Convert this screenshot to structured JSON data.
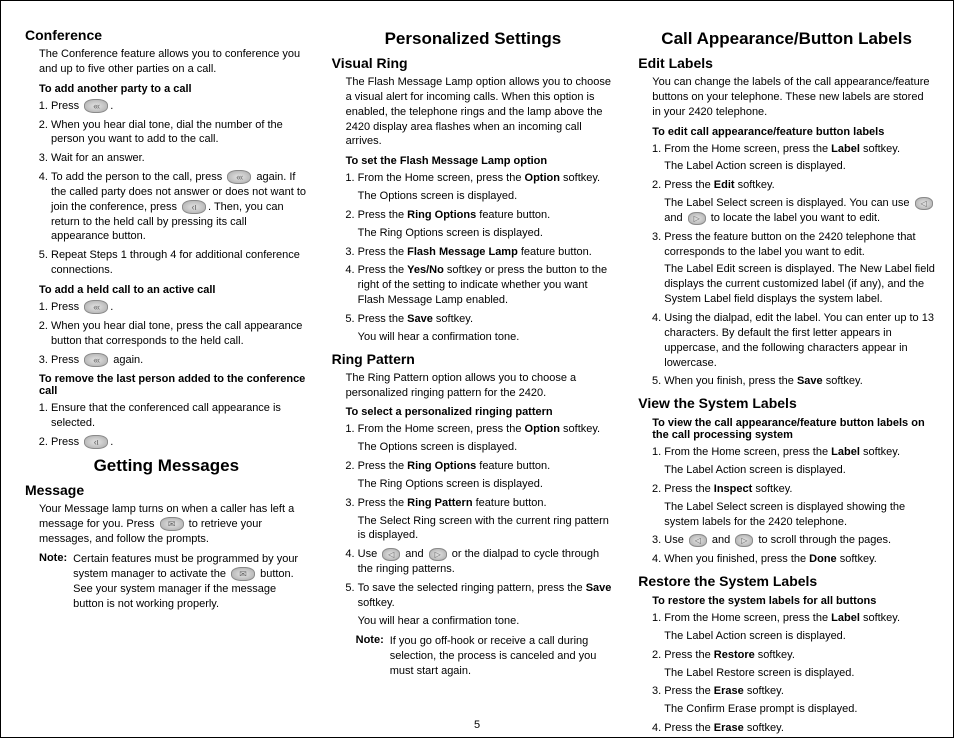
{
  "pageNumber": "5",
  "col1": {
    "conference": {
      "title": "Conference",
      "intro": "The Conference feature allows you to conference you and up to five other parties on a call.",
      "addParty": {
        "heading": "To add another party to a call",
        "s1a": "Press ",
        "s1b": ".",
        "s2": "When you hear dial tone, dial the number of the person you want to add to the call.",
        "s3": "Wait for an answer.",
        "s4a": "To add the person to the call, press ",
        "s4b": " again. If the called party does not answer or does not want to join the conference, press ",
        "s4c": ". Then, you can return to the held call by pressing its call appearance button.",
        "s5": "Repeat Steps 1 through 4 for additional conference connections."
      },
      "addHeld": {
        "heading": "To add a held call to an active call",
        "s1a": "Press ",
        "s1b": ".",
        "s2": "When you hear dial tone, press the call appearance button that corresponds to the held call.",
        "s3a": "Press ",
        "s3b": " again."
      },
      "removeLast": {
        "heading": "To remove the last person added to the conference call",
        "s1": "Ensure that the conferenced call appearance is selected.",
        "s2a": "Press ",
        "s2b": "."
      }
    },
    "gettingMessages": {
      "title": "Getting Messages",
      "messageHeading": "Message",
      "p1a": "Your Message lamp turns on when a caller has left a message for you. Press ",
      "p1b": " to retrieve your messages, and follow the prompts.",
      "noteLabel": "Note:",
      "noteA": "Certain features must be programmed by your system manager to activate the ",
      "noteB": " button. See your system manager if the message button is not working properly."
    }
  },
  "col2": {
    "title": "Personalized Settings",
    "visualRing": {
      "heading": "Visual Ring",
      "intro": "The Flash Message Lamp option allows you to choose a visual alert for incoming calls. When this option is enabled, the telephone rings and the lamp above the 2420 display area flashes when an incoming call arrives.",
      "procHeading": "To set the Flash Message Lamp option",
      "s1a": "From the Home screen, press the ",
      "s1b": "Option",
      "s1c": " softkey.",
      "s1r": "The Options screen is displayed.",
      "s2a": "Press the ",
      "s2b": "Ring Options",
      "s2c": " feature button.",
      "s2r": "The Ring Options screen is displayed.",
      "s3a": "Press the ",
      "s3b": "Flash Message Lamp",
      "s3c": " feature button.",
      "s4a": "Press the ",
      "s4b": "Yes/No",
      "s4c": " softkey or press the button to the right of the setting to indicate whether you want Flash Message Lamp enabled.",
      "s5a": "Press the ",
      "s5b": "Save",
      "s5c": " softkey.",
      "s5r": "You will hear a confirmation tone."
    },
    "ringPattern": {
      "heading": "Ring Pattern",
      "intro": "The Ring Pattern option allows you to choose a personalized ringing pattern for the 2420.",
      "procHeading": "To select a personalized ringing pattern",
      "s1a": "From the Home screen, press the ",
      "s1b": "Option",
      "s1c": " softkey.",
      "s1r": "The Options screen is displayed.",
      "s2a": "Press the ",
      "s2b": "Ring Options",
      "s2c": " feature button.",
      "s2r": "The Ring Options screen is displayed.",
      "s3a": "Press the ",
      "s3b": "Ring Pattern",
      "s3c": " feature button.",
      "s3r": "The Select Ring screen with the current ring pattern is displayed.",
      "s4a": "Use ",
      "s4b": " and ",
      "s4c": " or the dialpad to cycle through the ringing patterns.",
      "s5a": "To save the selected ringing pattern, press the ",
      "s5b": "Save",
      "s5c": " softkey.",
      "s5r": "You will hear a confirmation tone.",
      "noteLabel": "Note:",
      "noteText": "If you go off-hook or receive a call during selection, the process is canceled and you must start again."
    }
  },
  "col3": {
    "title": "Call Appearance/Button Labels",
    "editLabels": {
      "heading": "Edit Labels",
      "intro": "You can change the labels of the call appearance/feature buttons on your telephone. These new labels are stored in your 2420 telephone.",
      "procHeading": "To edit call appearance/feature button labels",
      "s1a": "From the Home screen, press the ",
      "s1b": "Label",
      "s1c": " softkey.",
      "s1r": "The Label Action screen is displayed.",
      "s2a": "Press the ",
      "s2b": "Edit",
      "s2c": " softkey.",
      "s2rA": "The Label Select screen is displayed. You can use ",
      "s2rB": " and ",
      "s2rC": " to locate the label you want to edit.",
      "s3": "Press the feature button on the 2420 telephone that corresponds to the label you want to edit.",
      "s3r": "The Label Edit screen is displayed. The New Label field displays the current customized label (if any), and the System Label field displays the system label.",
      "s4": "Using the dialpad, edit the label. You can enter up to 13 characters. By default the first letter appears in uppercase, and the following characters appear in lowercase.",
      "s5a": "When you finish, press the ",
      "s5b": "Save",
      "s5c": " softkey."
    },
    "viewLabels": {
      "heading": "View the System Labels",
      "procHeading": "To view the call appearance/feature button labels on the call processing system",
      "s1a": "From the Home screen, press the ",
      "s1b": "Label",
      "s1c": " softkey.",
      "s1r": "The Label Action screen is displayed.",
      "s2a": "Press the ",
      "s2b": "Inspect",
      "s2c": " softkey.",
      "s2r": "The Label Select screen is displayed showing the system labels for the 2420 telephone.",
      "s3a": "Use ",
      "s3b": " and ",
      "s3c": " to scroll through the pages.",
      "s4a": "When you finished, press the ",
      "s4b": "Done",
      "s4c": " softkey."
    },
    "restoreLabels": {
      "heading": "Restore the System Labels",
      "procHeading": "To restore the system labels for all buttons",
      "s1a": "From the Home screen, press the ",
      "s1b": "Label",
      "s1c": " softkey.",
      "s1r": "The Label Action screen is displayed.",
      "s2a": "Press the ",
      "s2b": "Restore",
      "s2c": " softkey.",
      "s2r": "The Label Restore screen is displayed.",
      "s3a": "Press the ",
      "s3b": "Erase",
      "s3c": " softkey.",
      "s3r": "The Confirm Erase prompt is displayed.",
      "s4a": "Press the ",
      "s4b": "Erase",
      "s4c": " softkey."
    }
  }
}
